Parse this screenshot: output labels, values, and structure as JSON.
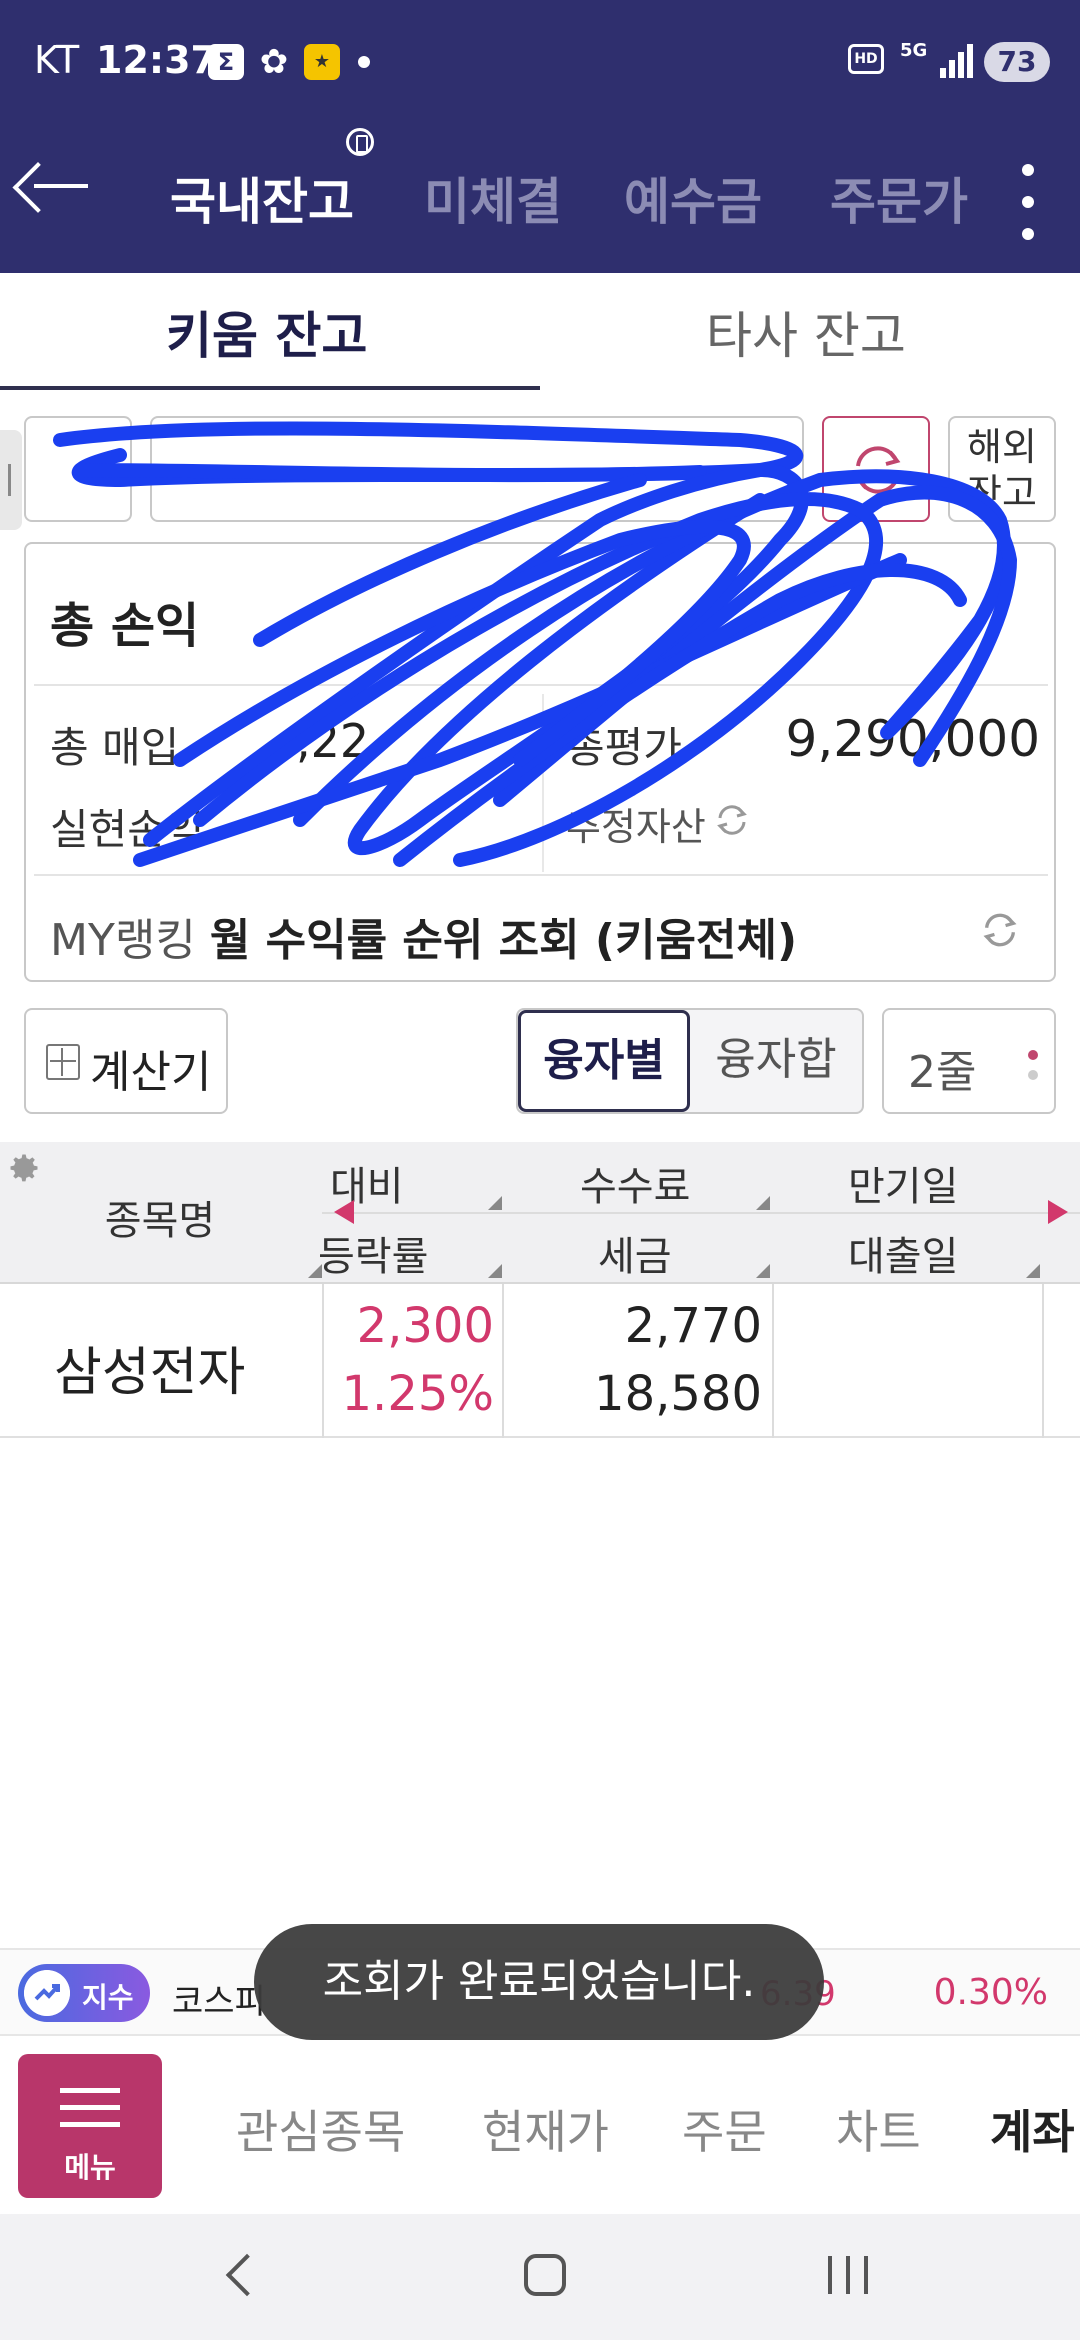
{
  "status_bar": {
    "carrier": "KT",
    "time": "12:37",
    "battery": "73",
    "network": "5G",
    "hd": "HD"
  },
  "header": {
    "tabs": [
      {
        "label": "국내잔고",
        "active": true
      },
      {
        "label": "미체결",
        "active": false
      },
      {
        "label": "예수금",
        "active": false
      },
      {
        "label": "주문가",
        "active": false
      }
    ]
  },
  "sub_tabs": {
    "kiwoom": "키움 잔고",
    "other": "타사 잔고"
  },
  "account": {
    "overseas_line1": "해외",
    "overseas_line2": "잔고"
  },
  "summary": {
    "total_pl_label": "총 손익",
    "total_buy_label": "총 매입",
    "total_buy_value": ",22",
    "total_eval_label": "총평가",
    "total_eval_value": "9,290,000",
    "realized_label": "실현손익",
    "estimated_asset_label": "추정자산",
    "ranking_prefix": "MY랭킹",
    "ranking_text": "월 수익률 순위 조회 (키움전체)"
  },
  "controls": {
    "calculator": "계산기",
    "by_loan": "융자별",
    "loan_sum": "융자합",
    "rows": "2줄"
  },
  "table": {
    "header": {
      "name": "종목명",
      "c1_top": "대비",
      "c1_bottom": "등락률",
      "c2_top": "수수료",
      "c2_bottom": "세금",
      "c3_top": "만기일",
      "c3_bottom": "대출일"
    },
    "rows": [
      {
        "name": "삼성전자",
        "change": "2,300",
        "rate": "1.25%",
        "fee": "2,770",
        "tax": "18,580"
      }
    ]
  },
  "ticker": {
    "badge": "지수",
    "name": "코스피",
    "value": "6.39",
    "rate": "0.30%"
  },
  "toast": "조회가 완료되었습니다.",
  "bottom_nav": {
    "menu": "메뉴",
    "items": [
      "관심종목",
      "현재가",
      "주문",
      "차트",
      "계좌"
    ]
  },
  "colors": {
    "header_bg": "#2f2f6e",
    "up_red": "#d2386c",
    "menu_bg": "#b8366a",
    "scribble": "#1a3ff0"
  }
}
